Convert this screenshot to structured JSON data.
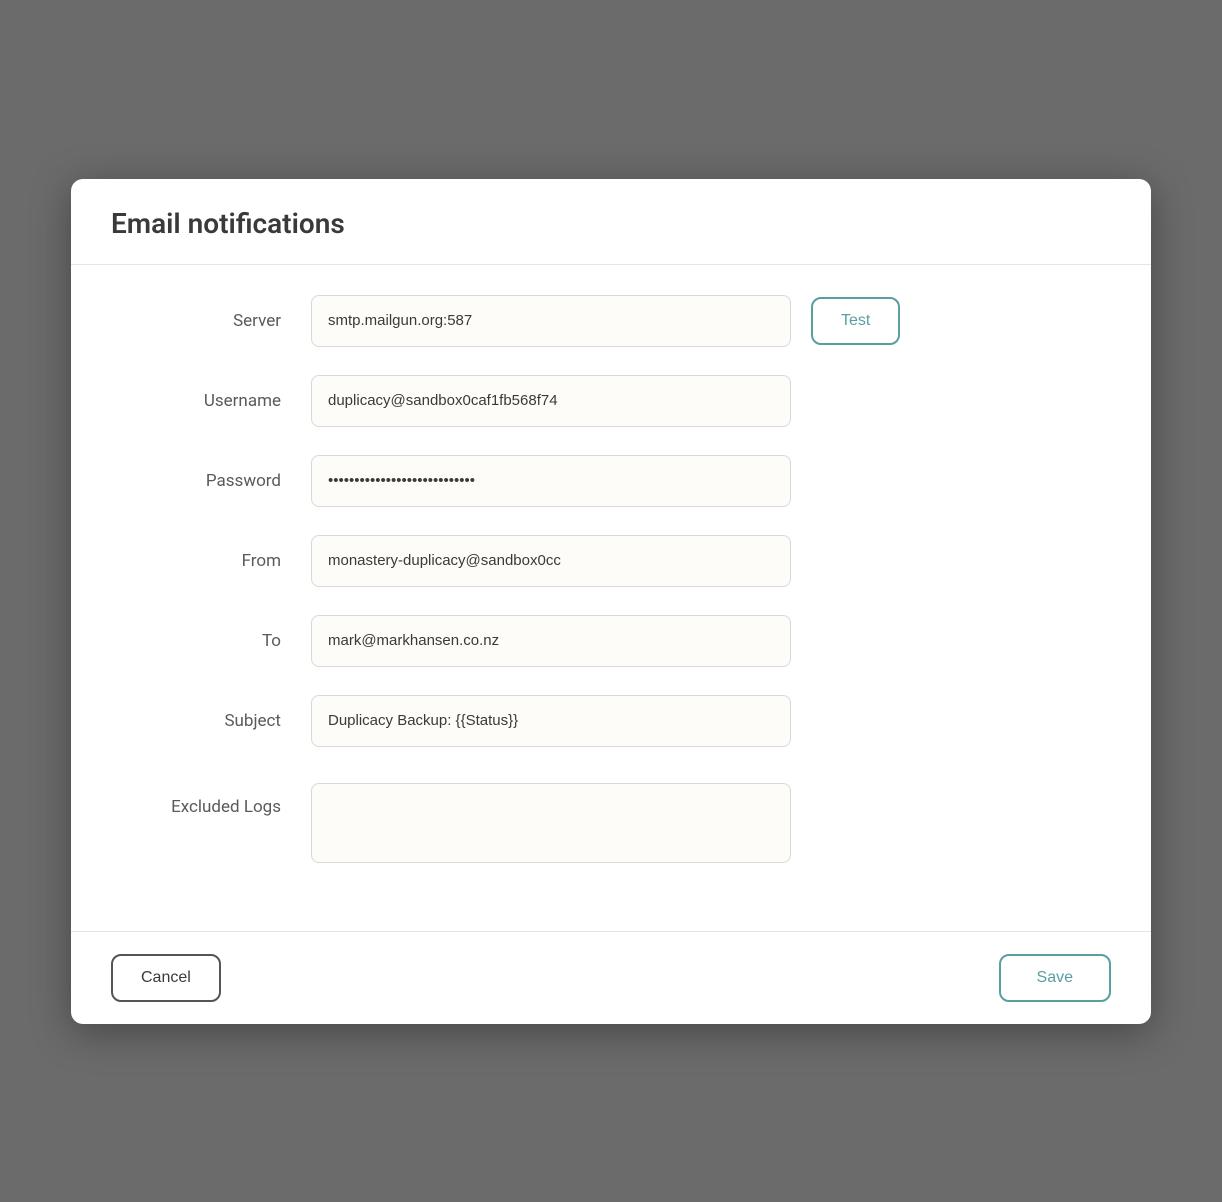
{
  "modal": {
    "title": "Email notifications",
    "fields": {
      "server": {
        "label": "Server",
        "value": "smtp.mailgun.org:587"
      },
      "username": {
        "label": "Username",
        "value": "duplicacy@sandbox0caf1fb568f74"
      },
      "password": {
        "label": "Password",
        "value": "••••••••••••••••••••••••••••"
      },
      "from": {
        "label": "From",
        "value": "monastery-duplicacy@sandbox0cc"
      },
      "to": {
        "label": "To",
        "value": "mark@markhansen.co.nz"
      },
      "subject": {
        "label": "Subject",
        "value": "Duplicacy Backup: {{Status}}"
      },
      "excluded_logs": {
        "label": "Excluded Logs",
        "value": ""
      }
    },
    "buttons": {
      "test": "Test",
      "cancel": "Cancel",
      "save": "Save"
    }
  }
}
